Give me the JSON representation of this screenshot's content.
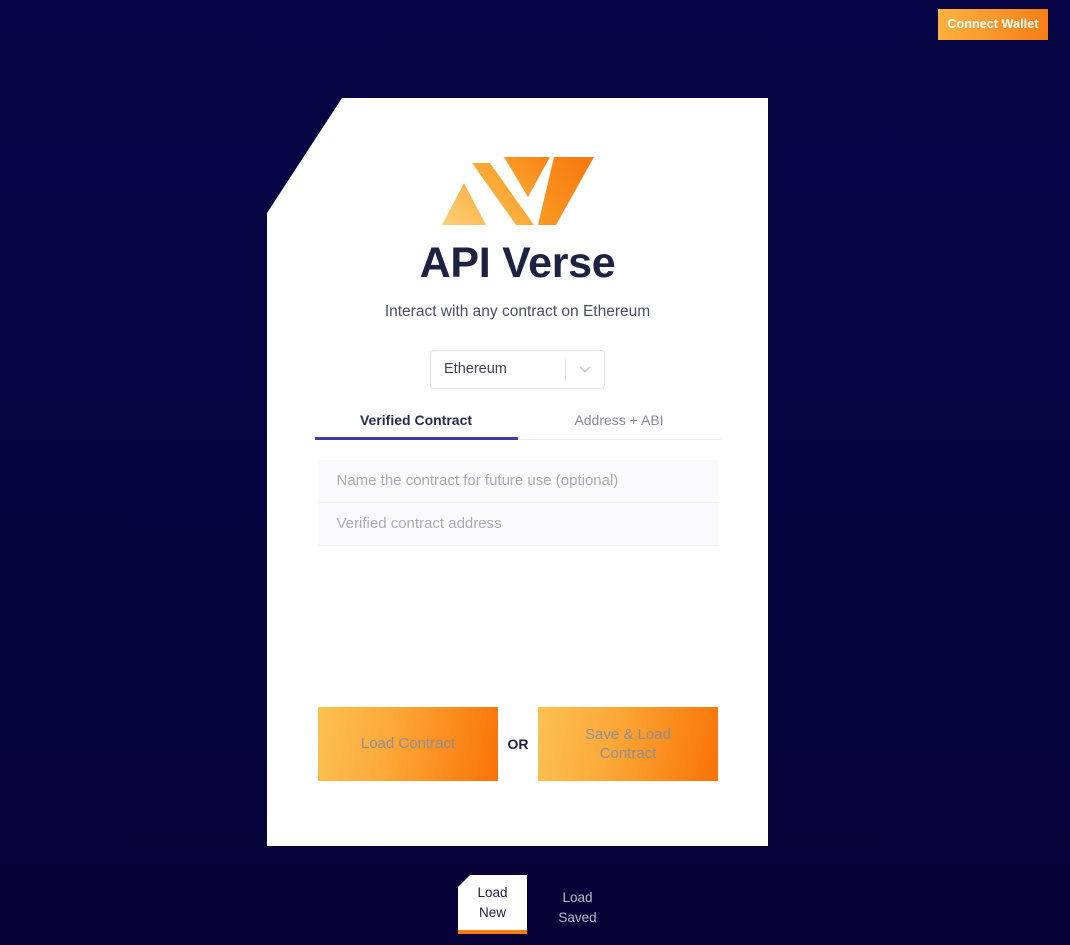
{
  "header": {
    "connect_wallet_label": "Connect Wallet"
  },
  "card": {
    "logo_name": "api-verse-logo",
    "title": "API Verse",
    "subtitle": "Interact with any contract on Ethereum",
    "network": {
      "selected": "Ethereum",
      "options": [
        "Ethereum"
      ],
      "chevron_icon": "chevron-down-icon"
    },
    "tabs": [
      {
        "label": "Verified Contract",
        "active": true
      },
      {
        "label": "Address + ABI",
        "active": false
      }
    ],
    "fields": [
      {
        "name": "contract-name-input",
        "value": "",
        "placeholder": "Name the contract for future use (optional)"
      },
      {
        "name": "contract-address-input",
        "value": "",
        "placeholder": "Verified contract address"
      }
    ],
    "actions": {
      "load_contract_label": "Load Contract",
      "or_label": "OR",
      "save_load_contract_label": "Save & Load Contract"
    }
  },
  "bottom_tabs": [
    {
      "label_line1": "Load",
      "label_line2": "New",
      "selected": true
    },
    {
      "label_line1": "Load",
      "label_line2": "Saved",
      "selected": false
    }
  ],
  "colors": {
    "background": "#070545",
    "accent_orange": "#f97b0e",
    "accent_orange_light": "#fcc153",
    "tab_indicator": "#3b3bb0",
    "title_navy": "#1d2142"
  }
}
